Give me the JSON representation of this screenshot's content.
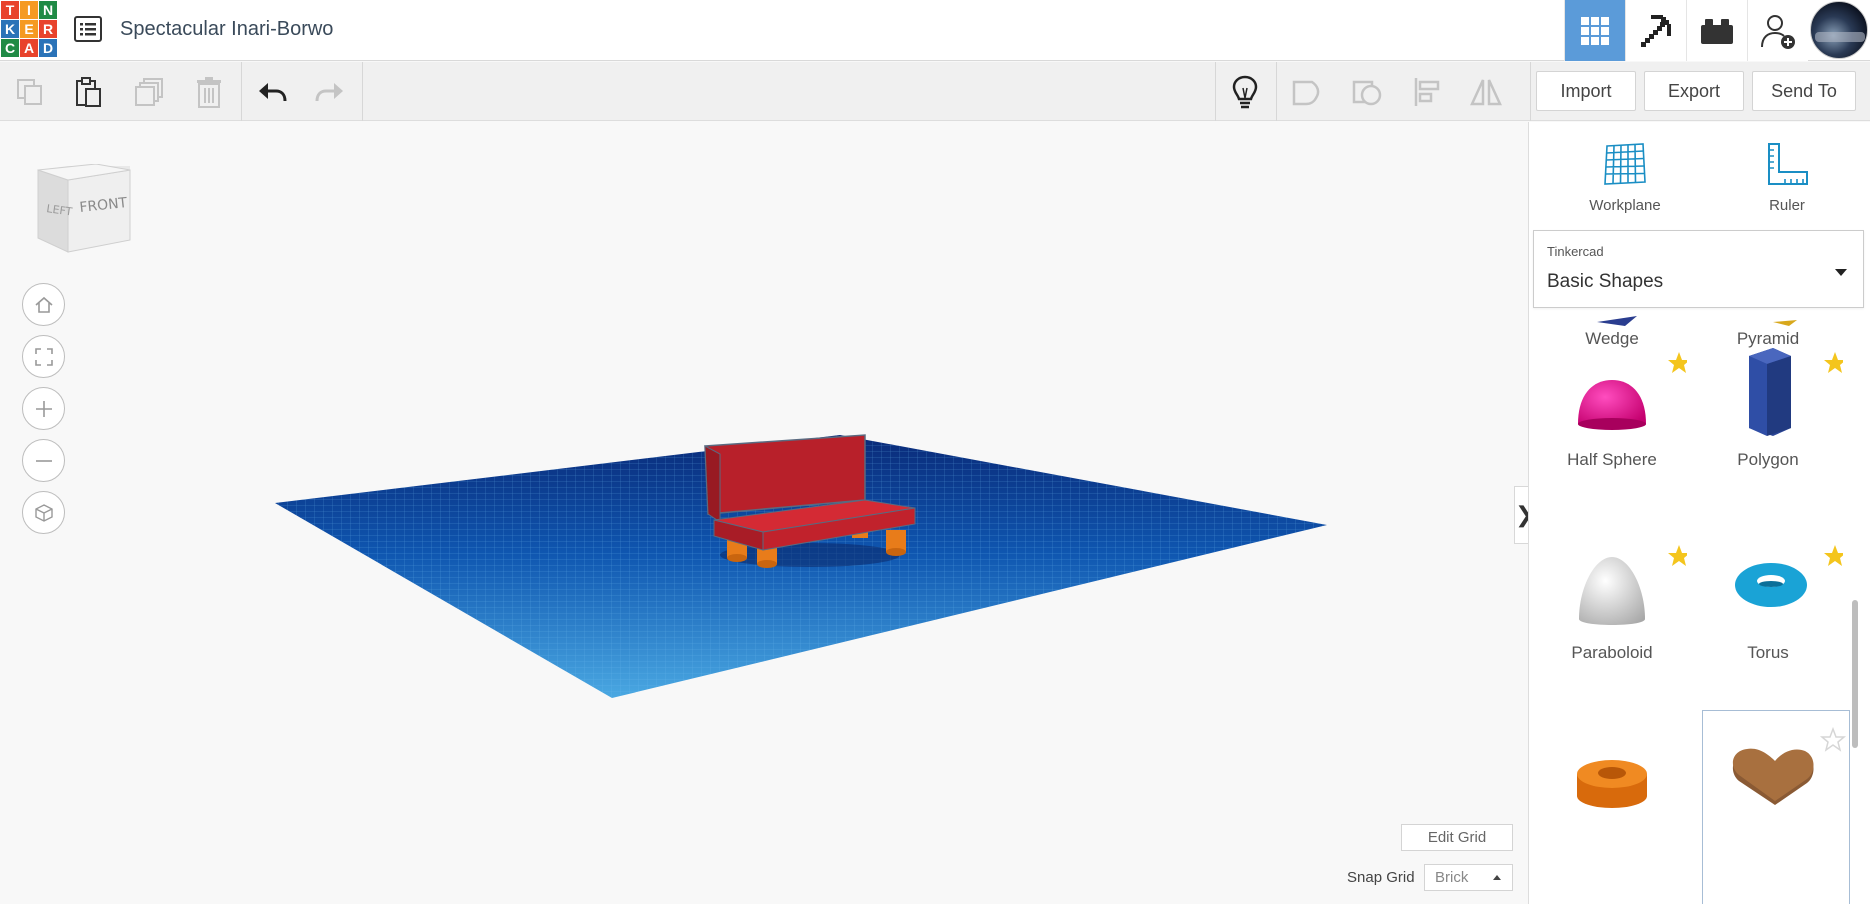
{
  "header": {
    "logo_letters": [
      "T",
      "I",
      "N",
      "K",
      "E",
      "R",
      "C",
      "A",
      "D"
    ],
    "logo_colors": [
      "#e8432c",
      "#f59a22",
      "#1f8a45",
      "#2a73b8",
      "#f59a22",
      "#e8432c",
      "#1f8a45",
      "#e8432c",
      "#2a73b8"
    ],
    "title": "Spectacular Inari-Borwo",
    "right_icons": [
      "3d-design-grid-icon",
      "codeblocks-pickaxe-icon",
      "bricks-icon",
      "add-user-icon"
    ]
  },
  "toolbar": {
    "left_icons": [
      "copy-icon",
      "paste-icon",
      "duplicate-icon",
      "delete-icon",
      "undo-icon",
      "redo-icon"
    ],
    "right_icons": [
      "note-lightbulb-icon",
      "show-all-icon",
      "hide-icon",
      "align-icon",
      "mirror-icon"
    ],
    "import_label": "Import",
    "export_label": "Export",
    "send_to_label": "Send To"
  },
  "viewcube": {
    "left_label": "LEFT",
    "front_label": "FRONT"
  },
  "canvas": {
    "nav_icons": [
      "home-icon",
      "fit-view-icon",
      "zoom-in-icon",
      "zoom-out-icon",
      "perspective-icon"
    ],
    "collapse_glyph": "❯",
    "edit_grid_label": "Edit Grid",
    "snap_grid_label": "Snap Grid",
    "snap_grid_value": "Brick",
    "colors": {
      "workplane": "#1d6fc2",
      "sofa": "#c0202a",
      "legs": "#e87c1a"
    }
  },
  "panel": {
    "workplane_label": "Workplane",
    "ruler_label": "Ruler",
    "library_source": "Tinkercad",
    "library_name": "Basic Shapes",
    "shapes": [
      {
        "label": "Wedge",
        "favorited": false
      },
      {
        "label": "Pyramid",
        "favorited": false
      },
      {
        "label": "Half Sphere",
        "favorited": true
      },
      {
        "label": "Polygon",
        "favorited": true
      },
      {
        "label": "Paraboloid",
        "favorited": true
      },
      {
        "label": "Torus",
        "favorited": true
      },
      {
        "label": "",
        "favorited": false
      },
      {
        "label": "",
        "favorited": false
      }
    ],
    "accent": "#1a8ec4",
    "star_color": "#f4c51d"
  }
}
